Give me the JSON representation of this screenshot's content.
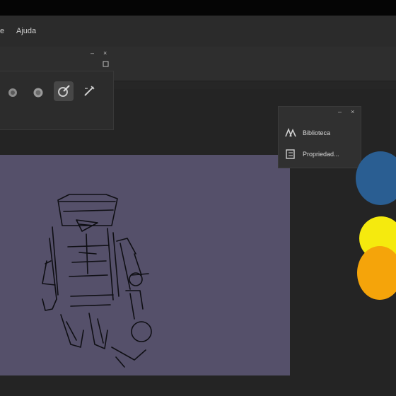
{
  "menubar": {
    "items": [
      {
        "label": "e"
      },
      {
        "label": "Ajuda"
      }
    ]
  },
  "toolbox": {
    "window_controls": {
      "minimize": "–",
      "close": "×"
    },
    "tools": [
      {
        "name": "brush-tool",
        "icon": "gear-brush-icon",
        "active": false
      },
      {
        "name": "blend-tool",
        "icon": "blend-icon",
        "active": false
      },
      {
        "name": "paint-tool",
        "icon": "paint-brush-icon",
        "active": true
      },
      {
        "name": "transform-tool",
        "icon": "wand-icon",
        "active": false
      }
    ]
  },
  "docker": {
    "window_controls": {
      "minimize": "–",
      "close": "×"
    },
    "items": [
      {
        "label": "Biblioteca"
      },
      {
        "label": "Propriedad..."
      }
    ]
  },
  "palette": {
    "colors": [
      "#2a5e92",
      "#f5ea0e",
      "#f5a40a"
    ]
  },
  "canvas": {
    "background": "#55506a"
  }
}
